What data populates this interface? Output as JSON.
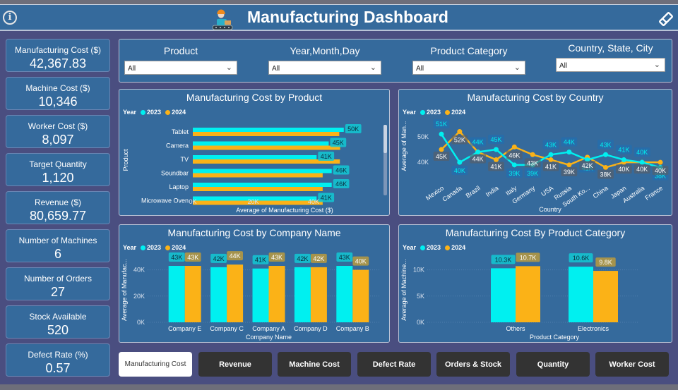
{
  "header": {
    "title": "Manufacturing Dashboard",
    "icons": [
      "info-icon",
      "factory-worker-icon",
      "eraser-icon"
    ]
  },
  "kpis": [
    {
      "label": "Manufacturing Cost ($)",
      "value": "42,367.83"
    },
    {
      "label": "Machine Cost ($)",
      "value": "10,346"
    },
    {
      "label": "Worker Cost ($)",
      "value": "8,097"
    },
    {
      "label": "Target Quantity",
      "value": "1,120"
    },
    {
      "label": "Revenue ($)",
      "value": "80,659.77"
    },
    {
      "label": "Number of Machines",
      "value": "6"
    },
    {
      "label": "Number of Orders",
      "value": "27"
    },
    {
      "label": "Stock Available",
      "value": "520"
    },
    {
      "label": "Defect Rate (%)",
      "value": "0.57"
    }
  ],
  "slicers": [
    {
      "title": "Product",
      "value": "All"
    },
    {
      "title": "Year,Month,Day",
      "value": "All"
    },
    {
      "title": "Product Category",
      "value": "All"
    },
    {
      "title": "Country, State, City",
      "value": "All"
    }
  ],
  "legend": {
    "title": "Year",
    "series": [
      "2023",
      "2024"
    ]
  },
  "colors": {
    "series_2023": "#00f0f0",
    "series_2024": "#fbb217",
    "panel": "#356a9c",
    "background": "#4a4e80"
  },
  "chart_data": [
    {
      "id": "by_product",
      "type": "bar",
      "orientation": "horizontal",
      "title": "Manufacturing Cost by Product",
      "xlabel": "Average of Manufacturing Cost ($)",
      "ylabel": "Product",
      "categories": [
        "Tablet",
        "Camera",
        "TV",
        "Soundbar",
        "Laptop",
        "Microwave Oven"
      ],
      "series": [
        {
          "name": "2023",
          "values": [
            50000,
            45000,
            41000,
            46000,
            46000,
            41000
          ],
          "labels": [
            "50K",
            "45K",
            "41K",
            "46K",
            "46K",
            "41K"
          ]
        },
        {
          "name": "2024",
          "values": [
            48500,
            48800,
            48700,
            43000,
            43000,
            43000
          ]
        }
      ],
      "xticks": [
        "0K",
        "20K",
        "40K"
      ],
      "xlim": [
        0,
        58000
      ]
    },
    {
      "id": "by_country",
      "type": "line",
      "title": "Manufacturing Cost by Country",
      "xlabel": "Country",
      "ylabel": "Average of Man...",
      "categories": [
        "Mexico",
        "Canada",
        "Brazil",
        "India",
        "Italy",
        "Germany",
        "USA",
        "Russia",
        "South Ko...",
        "China",
        "Japan",
        "Australia",
        "France"
      ],
      "series": [
        {
          "name": "2023",
          "values": [
            51000,
            40000,
            44000,
            45000,
            39000,
            39000,
            43000,
            44000,
            41000,
            43000,
            41000,
            40000,
            38000
          ],
          "labels": [
            "51K",
            "40K",
            "44K",
            "45K",
            "39K",
            "39K",
            "43K",
            "44K",
            "41K",
            "43K",
            "41K",
            "40K",
            "38K"
          ]
        },
        {
          "name": "2024",
          "values": [
            45000,
            52000,
            44000,
            41000,
            46000,
            43000,
            41000,
            39000,
            42000,
            38000,
            40000,
            40000,
            40000
          ],
          "labels": [
            "45K",
            "52K",
            "44K",
            "41K",
            "46K",
            "43K",
            "41K",
            "39K",
            "42K",
            "38K",
            "40K",
            "40K",
            "40K"
          ]
        }
      ],
      "yticks": [
        "40K",
        "50K"
      ],
      "ylim": [
        34000,
        56000
      ]
    },
    {
      "id": "by_company",
      "type": "bar",
      "title": "Manufacturing Cost by Company Name",
      "xlabel": "Company Name",
      "ylabel": "Average of Manufac...",
      "categories": [
        "Company E",
        "Company C",
        "Company A",
        "Company D",
        "Company B"
      ],
      "series": [
        {
          "name": "2023",
          "values": [
            43000,
            42000,
            41000,
            42000,
            43000
          ],
          "labels": [
            "43K",
            "42K",
            "41K",
            "42K",
            "43K"
          ]
        },
        {
          "name": "2024",
          "values": [
            43000,
            44000,
            43000,
            42000,
            40000
          ],
          "labels": [
            "43K",
            "44K",
            "43K",
            "42K",
            "40K"
          ]
        }
      ],
      "yticks": [
        "0K",
        "20K",
        "40K"
      ],
      "ylim": [
        0,
        50000
      ]
    },
    {
      "id": "by_category",
      "type": "bar",
      "title": "Manufacturing Cost By Product Category",
      "xlabel": "Product Category",
      "ylabel": "Average of Machine...",
      "categories": [
        "Others",
        "Electronics"
      ],
      "series": [
        {
          "name": "2023",
          "values": [
            10300,
            10600
          ],
          "labels": [
            "10.3K",
            "10.6K"
          ]
        },
        {
          "name": "2024",
          "values": [
            10700,
            9800
          ],
          "labels": [
            "10.7K",
            "9.8K"
          ]
        }
      ],
      "yticks": [
        "0K",
        "5K",
        "10K"
      ],
      "ylim": [
        0,
        12500
      ]
    }
  ],
  "nav_buttons": [
    {
      "label": "Manufacturing Cost",
      "active": true
    },
    {
      "label": "Revenue",
      "active": false
    },
    {
      "label": "Machine Cost",
      "active": false
    },
    {
      "label": "Defect Rate",
      "active": false
    },
    {
      "label": "Orders & Stock",
      "active": false
    },
    {
      "label": "Quantity",
      "active": false
    },
    {
      "label": "Worker Cost",
      "active": false
    }
  ]
}
